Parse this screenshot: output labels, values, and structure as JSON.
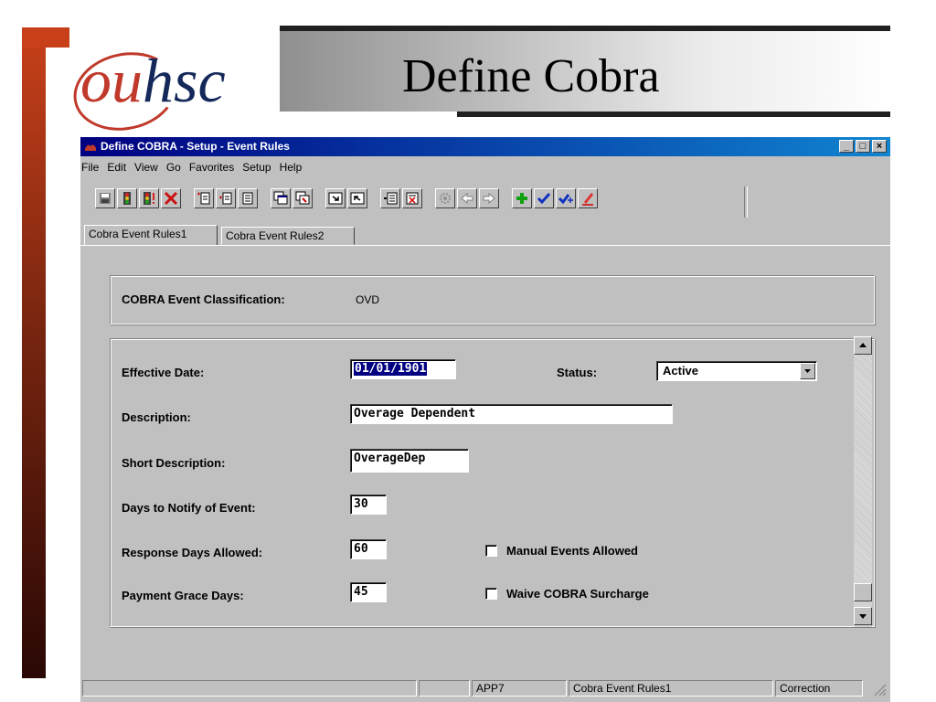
{
  "slide": {
    "title": "Define Cobra",
    "logo_prefix": "ou",
    "logo_suffix": "hsc"
  },
  "window": {
    "title": "Define COBRA - Setup - Event Rules",
    "controls": {
      "minimize": "_",
      "maximize": "□",
      "close": "×"
    }
  },
  "menu": [
    "File",
    "Edit",
    "View",
    "Go",
    "Favorites",
    "Setup",
    "Help"
  ],
  "toolbar": {
    "buttons": [
      "save-icon",
      "traffic-light-icon",
      "traffic-light-alert-icon",
      "delete-x-icon",
      "insert-row-before-icon",
      "insert-row-icon",
      "row-icon",
      "copy-window-icon",
      "paste-window-icon",
      "next-page-icon",
      "previous-page-icon",
      "insert-list-icon",
      "delete-list-icon",
      "gear-icon",
      "back-arrow-icon",
      "forward-arrow-icon",
      "add-plus-icon",
      "check-icon",
      "check-add-icon",
      "edit-pencil-icon"
    ]
  },
  "tabs": [
    {
      "label": "Cobra Event Rules1",
      "active": true
    },
    {
      "label": "Cobra Event Rules2",
      "active": false
    }
  ],
  "form": {
    "classification_label": "COBRA Event Classification:",
    "classification_value": "OVD",
    "effective_date_label": "Effective Date:",
    "effective_date": "01/01/1901",
    "status_label": "Status:",
    "status": "Active",
    "description_label": "Description:",
    "description": "Overage Dependent",
    "short_description_label": "Short Description:",
    "short_description": "OverageDep",
    "days_notify_label": "Days to Notify of Event:",
    "days_notify": "30",
    "response_days_label": "Response Days Allowed:",
    "response_days": "60",
    "payment_grace_label": "Payment Grace Days:",
    "payment_grace": "45",
    "manual_events_label": "Manual Events Allowed",
    "manual_events_checked": false,
    "waive_surcharge_label": "Waive COBRA Surcharge",
    "waive_surcharge_checked": false
  },
  "statusbar": {
    "panel1": "",
    "panel2": "",
    "app": "APP7",
    "page": "Cobra Event Rules1",
    "mode": "Correction"
  },
  "colors": {
    "titlebar_start": "#000080",
    "titlebar_end": "#1084d0",
    "slide_accent": "#c8401a",
    "logo_red": "#c0392b",
    "logo_navy": "#14285a"
  }
}
